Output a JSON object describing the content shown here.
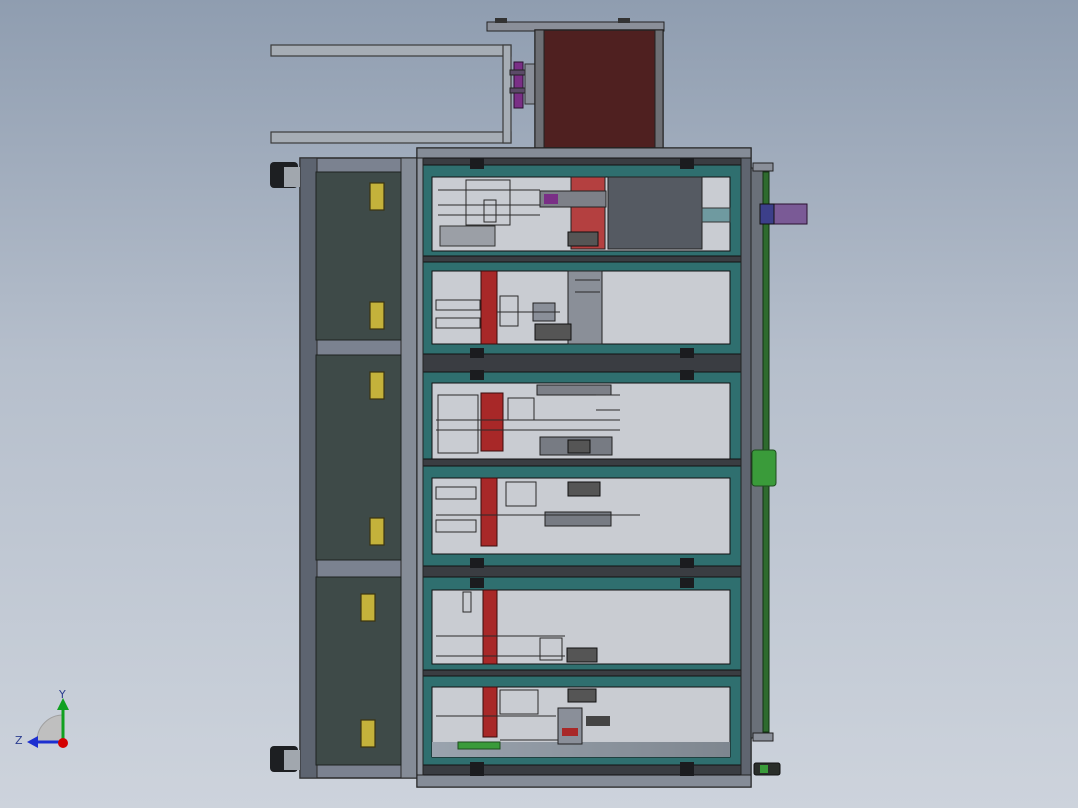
{
  "triad": {
    "y_label": "Y",
    "z_label": "Z",
    "x_color": "#d40000",
    "y_color": "#10a020",
    "z_color": "#1d2fd0"
  },
  "colors": {
    "frame_teal": "#2f6f6f",
    "cabinet_panel": "#3e4a48",
    "cabinet_handle": "#c4b23b",
    "top_box": "#4f2020",
    "red_column": "#a82828",
    "green_pad": "#3a9b3a",
    "purple_cylinder": "#7a2f86"
  }
}
